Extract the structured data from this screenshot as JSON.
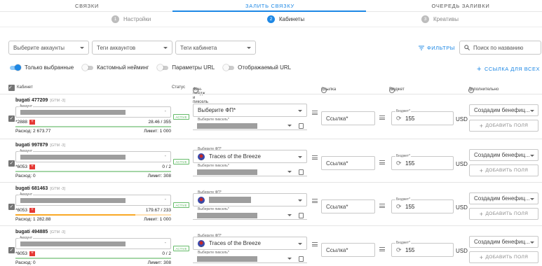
{
  "tabs": [
    {
      "label": "СВЯЗКИ",
      "active": false
    },
    {
      "label": "ЗАЛИТЬ СВЯЗКУ",
      "active": true
    },
    {
      "label": "ОЧЕРЕДЬ ЗАЛИВКИ",
      "active": false
    }
  ],
  "steps": [
    {
      "num": "1",
      "label": "Настройки"
    },
    {
      "num": "2",
      "label": "Кабинеты"
    },
    {
      "num": "3",
      "label": "Креативы"
    }
  ],
  "filters": {
    "select_accounts": "Выберите аккаунты",
    "account_tags": "Теги аккаунтов",
    "cabinet_tags": "Теги кабинета",
    "filters_btn": "ФИЛЬТРЫ",
    "search_placeholder": "Поиск по названию"
  },
  "toggles": [
    {
      "label": "Только выбранные",
      "on": true
    },
    {
      "label": "Кастомный нейминг",
      "on": false
    },
    {
      "label": "Параметры URL",
      "on": false
    },
    {
      "label": "Отображаемый URL",
      "on": false
    }
  ],
  "link_all": "ССЫЛКА ДЛЯ ВСЕХ",
  "table": {
    "col_cabinet": "Кабинет",
    "col_status": "Статус",
    "col_fp": "Фан-пейдж и пиксель",
    "col_link": "Ссылка",
    "col_budget": "Бюджет",
    "col_extra": "Дополнительно"
  },
  "common": {
    "account_label": "Аккаунт",
    "status": "ACTIVE",
    "fp_label": "Выберите ФП*",
    "pixel_label": "Выберите пиксель*",
    "link_placeholder": "Ссылка*",
    "budget_label": "Бюджет*",
    "currency": "USD",
    "benef_placeholder": "Создадим бенефиц...",
    "add_field": "ДОБАВИТЬ ПОЛЯ",
    "gtm": "[GTM -3]",
    "spend_prefix": "Расход:",
    "limit_prefix": "Лимит:"
  },
  "rows": [
    {
      "name": "bugati 477209",
      "card": "*2888",
      "ratio": "28.46 / 355",
      "spend": "Расход: 2 673.77",
      "limit": "Лимит: 1 000",
      "fp": "Выберите ФП*",
      "fp_selected": false,
      "budget": "155",
      "progress": 0.08,
      "bar_color": "#a5d6a7"
    },
    {
      "name": "bugati 997879",
      "card": "*6053",
      "ratio": "0 / 2",
      "spend": "Расход: 0",
      "limit": "Лимит: 308",
      "fp": "Traces of the Breeze",
      "fp_selected": true,
      "budget": "155",
      "progress": 0,
      "bar_color": "#a5d6a7"
    },
    {
      "name": "bugati 681463",
      "card": "*6053",
      "ratio": "179.67 / 233",
      "spend": "Расход: 1 282.88",
      "limit": "Лимит: 1 000",
      "fp": "",
      "fp_selected": true,
      "budget": "155",
      "progress": 0.77,
      "bar_color": "#f9a825"
    },
    {
      "name": "bugati 494885",
      "card": "*6053",
      "ratio": "0 / 2",
      "spend": "Расход: 0",
      "limit": "Лимит: 308",
      "fp": "Traces of the Breeze",
      "fp_selected": true,
      "budget": "155",
      "progress": 0,
      "bar_color": "#a5d6a7"
    }
  ]
}
